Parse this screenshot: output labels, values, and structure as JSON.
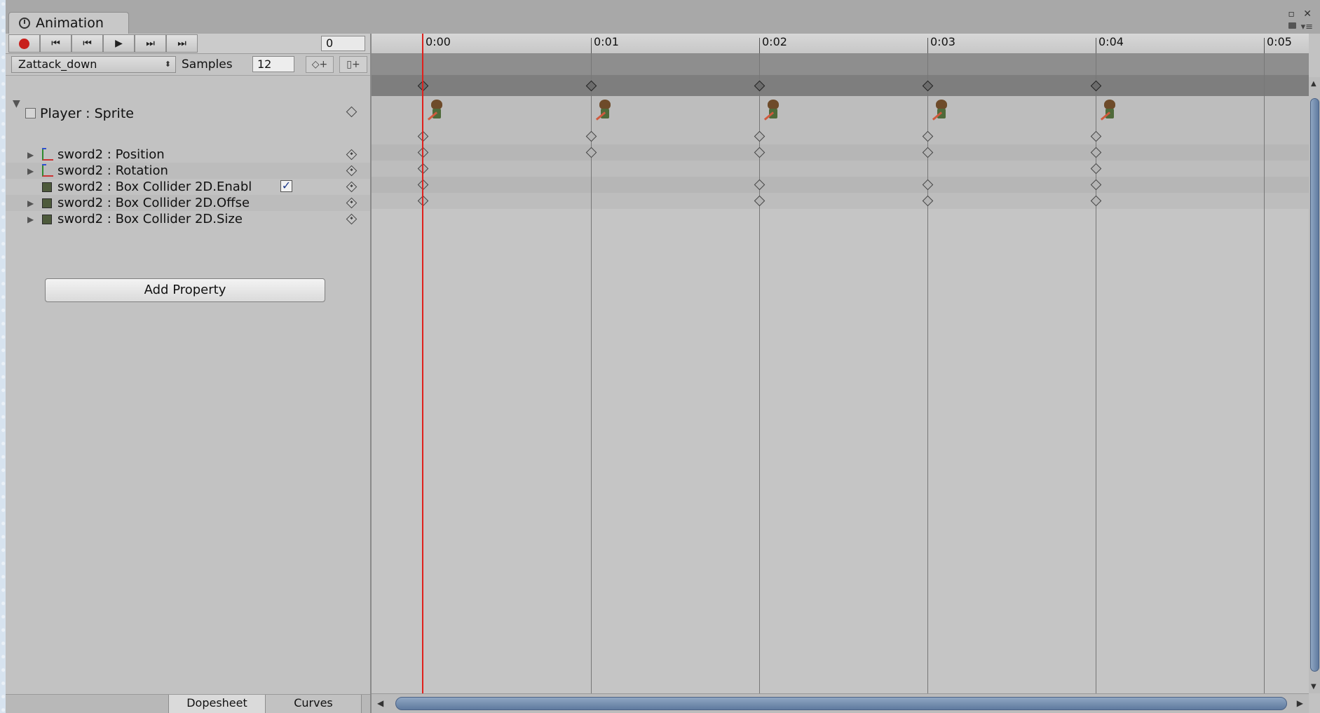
{
  "window": {
    "tab_title": "Animation",
    "controls": "▫ ✕",
    "menu_icon": "▾≡"
  },
  "toolbar": {
    "record_icon": "record-icon",
    "first_frame_glyph": "⏮",
    "prev_frame_glyph": "⏮",
    "play_glyph": "▶",
    "next_frame_glyph": "⏭",
    "last_frame_glyph": "⏭",
    "frame_value": "0"
  },
  "clip": {
    "name": "Zattack_down",
    "samples_label": "Samples",
    "samples_value": "12",
    "add_keyframe_glyph": "◇+",
    "add_event_glyph": "▯+"
  },
  "properties": {
    "root": "Player : Sprite",
    "items": [
      {
        "label": "sword2 : Position",
        "icon": "transform-axes-icon",
        "expandable": true
      },
      {
        "label": "sword2 : Rotation",
        "icon": "transform-axes-icon",
        "expandable": true
      },
      {
        "label": "sword2 : Box Collider 2D.Enabl",
        "icon": "box-collider-icon",
        "expandable": false,
        "checked": true
      },
      {
        "label": "sword2 : Box Collider 2D.Offse",
        "icon": "box-collider-icon",
        "expandable": true
      },
      {
        "label": "sword2 : Box Collider 2D.Size",
        "icon": "box-collider-icon",
        "expandable": true
      }
    ],
    "add_property_label": "Add Property"
  },
  "bottom_tabs": {
    "dopesheet": "Dopesheet",
    "curves": "Curves",
    "active": "Dopesheet"
  },
  "timeline": {
    "time_labels": [
      "0:00",
      "0:01",
      "0:02",
      "0:03",
      "0:04",
      "0:05"
    ],
    "current_time": "0:00",
    "playhead_color": "#e0201c",
    "keyframes": {
      "summary": [
        "0:00",
        "0:01",
        "0:02",
        "0:03",
        "0:04"
      ],
      "sprite": [
        "0:00",
        "0:01",
        "0:02",
        "0:03",
        "0:04"
      ],
      "position": [
        "0:00",
        "0:01",
        "0:02",
        "0:03",
        "0:04"
      ],
      "rotation": [
        "0:00",
        "0:01",
        "0:02",
        "0:03",
        "0:04"
      ],
      "enabled": [
        "0:00",
        "0:04"
      ],
      "offset": [
        "0:00",
        "0:02",
        "0:03",
        "0:04"
      ],
      "size": [
        "0:00",
        "0:02",
        "0:03",
        "0:04"
      ]
    }
  }
}
